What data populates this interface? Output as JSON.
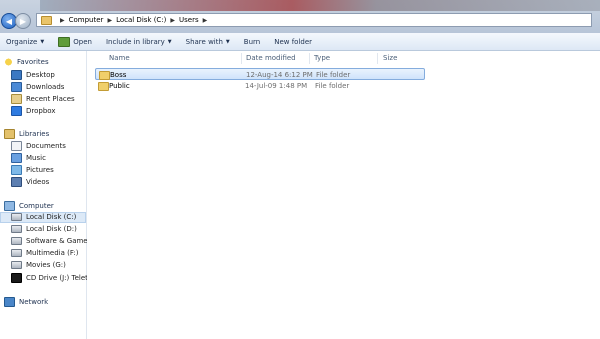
{
  "address": {
    "breadcrumbs": [
      "Computer",
      "Local Disk (C:)",
      "Users"
    ]
  },
  "toolbar": {
    "organize": "Organize",
    "open": "Open",
    "include_in_library": "Include in library",
    "share_with": "Share with",
    "burn": "Burn",
    "new_folder": "New folder"
  },
  "nav": {
    "favorites": {
      "label": "Favorites",
      "items": [
        "Desktop",
        "Downloads",
        "Recent Places",
        "Dropbox"
      ]
    },
    "libraries": {
      "label": "Libraries",
      "items": [
        "Documents",
        "Music",
        "Pictures",
        "Videos"
      ]
    },
    "computer": {
      "label": "Computer",
      "items": [
        "Local Disk (C:)",
        "Local Disk (D:)",
        "Software & Games (",
        "Multimedia (F:)",
        "Movies (G:)",
        "CD Drive (J:) Teletalk"
      ],
      "selected": "Local Disk (C:)"
    },
    "network": {
      "label": "Network"
    }
  },
  "columns": {
    "name": "Name",
    "date_modified": "Date modified",
    "type": "Type",
    "size": "Size"
  },
  "files": [
    {
      "name": "Boss",
      "date": "12-Aug-14 6:12 PM",
      "type": "File folder",
      "selected": true
    },
    {
      "name": "Public",
      "date": "14-Jul-09 1:48 PM",
      "type": "File folder",
      "selected": false
    }
  ]
}
